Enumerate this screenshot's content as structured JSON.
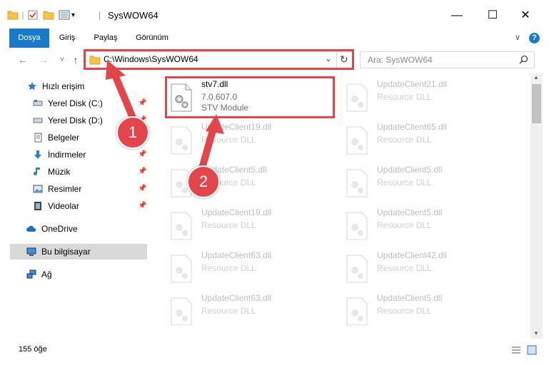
{
  "window": {
    "title": "SysWOW64",
    "minimize_glyph": "—",
    "maximize_glyph": "☐",
    "close_glyph": "✕"
  },
  "ribbon": {
    "tabs": [
      {
        "label": "Dosya"
      },
      {
        "label": "Giriş"
      },
      {
        "label": "Paylaş"
      },
      {
        "label": "Görünüm"
      }
    ],
    "expand_glyph": "∨",
    "help_glyph": "?"
  },
  "navigation": {
    "back_glyph": "←",
    "forward_glyph": "→",
    "recent_glyph": "˅",
    "up_glyph": "↑"
  },
  "address": {
    "path": "C:\\Windows\\SysWOW64"
  },
  "search": {
    "placeholder": "Ara: SysWOW64"
  },
  "sidebar": {
    "items": [
      {
        "label": "Hızlı erişim",
        "icon": "star-icon"
      },
      {
        "label": "Yerel Disk (C:)",
        "icon": "drive-icon",
        "pinned": true
      },
      {
        "label": "Yerel Disk (D:)",
        "icon": "drive-icon",
        "pinned": true
      },
      {
        "label": "Belgeler",
        "icon": "documents-icon"
      },
      {
        "label": "İndirmeler",
        "icon": "download-icon",
        "pinned": true
      },
      {
        "label": "Müzik",
        "icon": "music-icon",
        "pinned": true
      },
      {
        "label": "Resimler",
        "icon": "pictures-icon",
        "pinned": true
      },
      {
        "label": "Videolar",
        "icon": "video-icon",
        "pinned": true
      },
      {
        "label": "OneDrive",
        "icon": "cloud-icon"
      },
      {
        "label": "Bu bilgisayar",
        "icon": "computer-icon",
        "selected": true
      },
      {
        "label": "Ağ",
        "icon": "network-icon"
      }
    ]
  },
  "files": {
    "highlighted": {
      "name": "stv7.dll",
      "version": "7.0.607.0",
      "description": "STV Module"
    },
    "faded": [
      {
        "name": "UpdateClient21.dll",
        "type": "Resource DLL"
      },
      {
        "name": "UpdateClient19.dll",
        "type": "Resource DLL"
      },
      {
        "name": "UpdateClient65.dll",
        "type": "Resource DLL"
      },
      {
        "name": "UpdateClient5.dll",
        "type": "Resource DLL"
      },
      {
        "name": "UpdateClient5.dll",
        "type": "Resource DLL"
      },
      {
        "name": "UpdateClient19.dll",
        "type": "Resource DLL"
      },
      {
        "name": "UpdateClient5.dll",
        "type": "Resource DLL"
      },
      {
        "name": "UpdateClient63.dll",
        "type": "Resource DLL"
      },
      {
        "name": "UpdateClient42.dll",
        "type": "Resource DLL"
      },
      {
        "name": "UpdateClient63.dll",
        "type": "Resource DLL"
      },
      {
        "name": "UpdateClient5.dll",
        "type": "Resource DLL"
      }
    ]
  },
  "status": {
    "item_count": "155 öğe"
  },
  "annotations": {
    "step1": "1",
    "step2": "2",
    "color": "#e2454a"
  },
  "colors": {
    "file_tab": "#1979ca",
    "selected_bg": "#d9d9d9"
  }
}
